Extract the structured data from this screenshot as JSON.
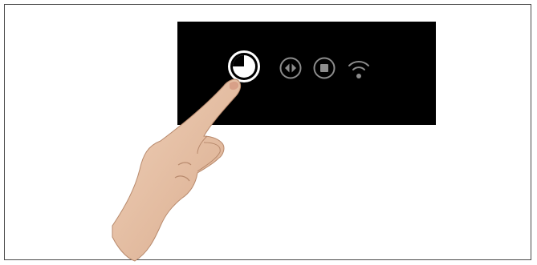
{
  "colors": {
    "background": "#ffffff",
    "frame_border": "#4a4a4a",
    "panel": "#000000",
    "icon_active": "#ffffff",
    "icon_inactive": "#8c8c8c",
    "skin": "#e8c3a8"
  },
  "controls": [
    {
      "icon": "timer-icon",
      "state": "active"
    },
    {
      "icon": "skip-icon",
      "state": "inactive"
    },
    {
      "icon": "stop-icon",
      "state": "inactive"
    },
    {
      "icon": "wifi-icon",
      "state": "inactive"
    }
  ],
  "pointer": {
    "icon": "hand-pointer",
    "target": "timer-icon"
  }
}
